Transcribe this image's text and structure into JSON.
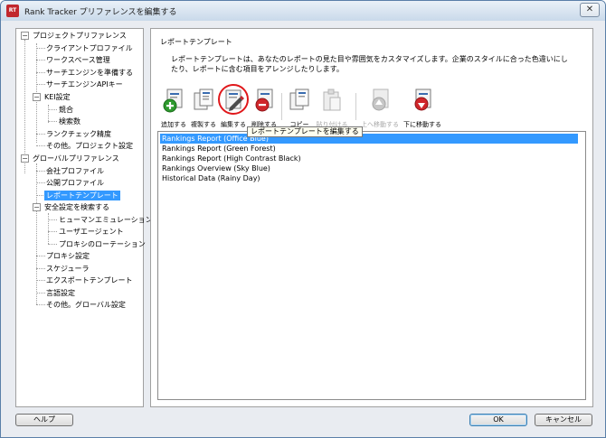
{
  "window": {
    "title": "Rank Tracker プリファレンスを編集する",
    "app_icon": "rank-tracker-icon",
    "close_glyph": "✕"
  },
  "tree": {
    "items": [
      {
        "label": "プロジェクトプリファレンス",
        "expander": "−"
      },
      {
        "label": "クライアントプロファイル"
      },
      {
        "label": "ワークスペース管理"
      },
      {
        "label": "サーチエンジンを準備する"
      },
      {
        "label": "サーチエンジンAPIキー"
      },
      {
        "label": "KEI設定",
        "expander": "−"
      },
      {
        "label": "競合"
      },
      {
        "label": "検索数"
      },
      {
        "label": "ランクチェック精度"
      },
      {
        "label": "その他。プロジェクト設定"
      },
      {
        "label": "グローバルプリファレンス",
        "expander": "−"
      },
      {
        "label": "会社プロファイル"
      },
      {
        "label": "公開プロファイル"
      },
      {
        "label": "レポートテンプレート",
        "selected": true
      },
      {
        "label": "安全設定を検索する",
        "expander": "−"
      },
      {
        "label": "ヒューマンエミュレーション"
      },
      {
        "label": "ユーザエージェント"
      },
      {
        "label": "プロキシのローテーション"
      },
      {
        "label": "プロキシ設定"
      },
      {
        "label": "スケジューラ"
      },
      {
        "label": "エクスポートテンプレート"
      },
      {
        "label": "言語設定"
      },
      {
        "label": "その他。グローバル設定"
      }
    ]
  },
  "main": {
    "title": "レポートテンプレート",
    "description": "レポートテンプレートは、あなたのレポートの見た目や雰囲気をカスタマイズします。企業のスタイルに合った色違いにしたり、レポートに含む項目をアレンジしたりします。",
    "toolbar": {
      "add": {
        "label": "追加する",
        "icon": "add-template-icon"
      },
      "copy": {
        "label": "複製する",
        "icon": "copy-template-icon"
      },
      "edit": {
        "label": "編集する",
        "icon": "edit-template-icon"
      },
      "delete": {
        "label": "削除する",
        "icon": "delete-template-icon"
      },
      "copy2": {
        "label": "コピー",
        "icon": "copy-icon"
      },
      "paste": {
        "label": "貼り付ける",
        "icon": "paste-icon",
        "disabled": true
      },
      "move_up": {
        "label": "上へ移動する",
        "icon": "move-up-icon",
        "disabled": true
      },
      "move_down": {
        "label": "下に移動する",
        "icon": "move-down-icon"
      }
    },
    "tooltip": "レポートテンプレートを編集する",
    "templates": [
      "Rankings Report (Office Blue)",
      "Rankings Report (Green Forest)",
      "Rankings Report (High Contrast Black)",
      "Rankings Overview (Sky Blue)",
      "Historical Data (Rainy Day)"
    ],
    "selected_template_index": 0
  },
  "buttons": {
    "help": "ヘルプ",
    "ok": "OK",
    "cancel": "キャンセル"
  },
  "colors": {
    "selection": "#3399ff",
    "highlight_ring": "#e0181b",
    "add_green": "#2e9a2e",
    "delete_red": "#d0262b"
  }
}
